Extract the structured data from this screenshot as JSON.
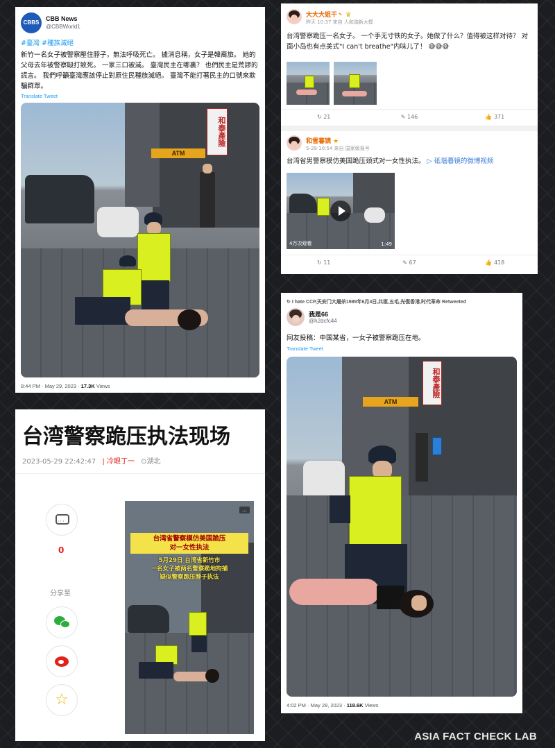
{
  "card1": {
    "logo": "CBBS",
    "name": "CBB News",
    "handle": "@CBBWorld1",
    "hashtags": "#臺灣 #種族滅絕",
    "body": "新竹一名女子被警察壓住脖子，無法呼吸死亡。 據消息稱，女子是韓裔旅。 她的父母去年被警察毆打致死。 一家三口被滅。 臺灣民主在哪裏？ 也們民主是荒謬的謊言。 我們呼籲臺灣應該停止對原住民種族滅絕。 臺灣不能打著民主的口號來欺騙群眾。",
    "translate": "Translate Tweet",
    "time": "8:44 PM · May 29, 2023 · ",
    "views": "17.3K",
    "views_label": " Views",
    "photo_sign": "和泰產險",
    "photo_atm": "ATM"
  },
  "card2": {
    "post1": {
      "name": "大大大姐干丶",
      "badge": "♛",
      "sub": "昨天 10:37 来自 人和谐新大模",
      "text": "台湾警察跪压一名女子。 一个手无寸铁的女子。她做了什么？值得被这样对待？ 对面小岛也有点美式\"I can't breathe\"内味儿了！",
      "emoji": "😅😅😅",
      "repost": "21",
      "comment": "146",
      "like": "371"
    },
    "post2": {
      "name": "和雪暮镜",
      "badge": "★",
      "sub": "5-29 10:54 来自 国家级报号",
      "text": "台湾省男警察模仿美国跪压颈式对一女性执法。",
      "link": "▷ 砥瑙暮镜的微博视频",
      "video_views": "4万次观看",
      "video_time": "1:49",
      "repost": "11",
      "comment": "67",
      "like": "418"
    },
    "icons": {
      "repost": "↻",
      "comment": "✎",
      "like": "👍"
    }
  },
  "card3": {
    "title": "台湾警察跪压执法现场",
    "datetime": "2023-05-29 22:42:47",
    "author": "冷眼丁一",
    "location": "湖北",
    "comments_count": "0",
    "share_label": "分享至",
    "video_badge": "…",
    "caption_line1": "台湾省警察模仿美国跪压",
    "caption_line2": "对一女性执法",
    "caption_line3": "5月29日 台湾省新竹市",
    "caption_line4": "一名女子被两名警察跪地拘捕",
    "caption_line5": "疑似警察跪压脖子执法"
  },
  "card4": {
    "retweet": "I hate CCP,天安门大屠杀1989年6月4日,共匪,五毛,光復香港,时代革命 Retweeted",
    "name": "我是66",
    "handle": "@h2dcfc44",
    "body": "网友投稿：中国某省，一女子被警察跪压在地。",
    "translate": "Translate Tweet",
    "time": "4:02 PM · May 28, 2023 · ",
    "views": "118.6K",
    "views_label": " Views",
    "photo_sign": "和泰產險",
    "photo_atm": "ATM"
  },
  "watermark": "ASIA FACT CHECK LAB",
  "colors": {
    "background": "#1c1d20",
    "twitter_blue": "#1d9bf0",
    "weibo_orange": "#e86a00",
    "vest_yellow": "#d9ef20",
    "uniform_navy": "#1f2736",
    "accent_red": "#e0221b"
  }
}
